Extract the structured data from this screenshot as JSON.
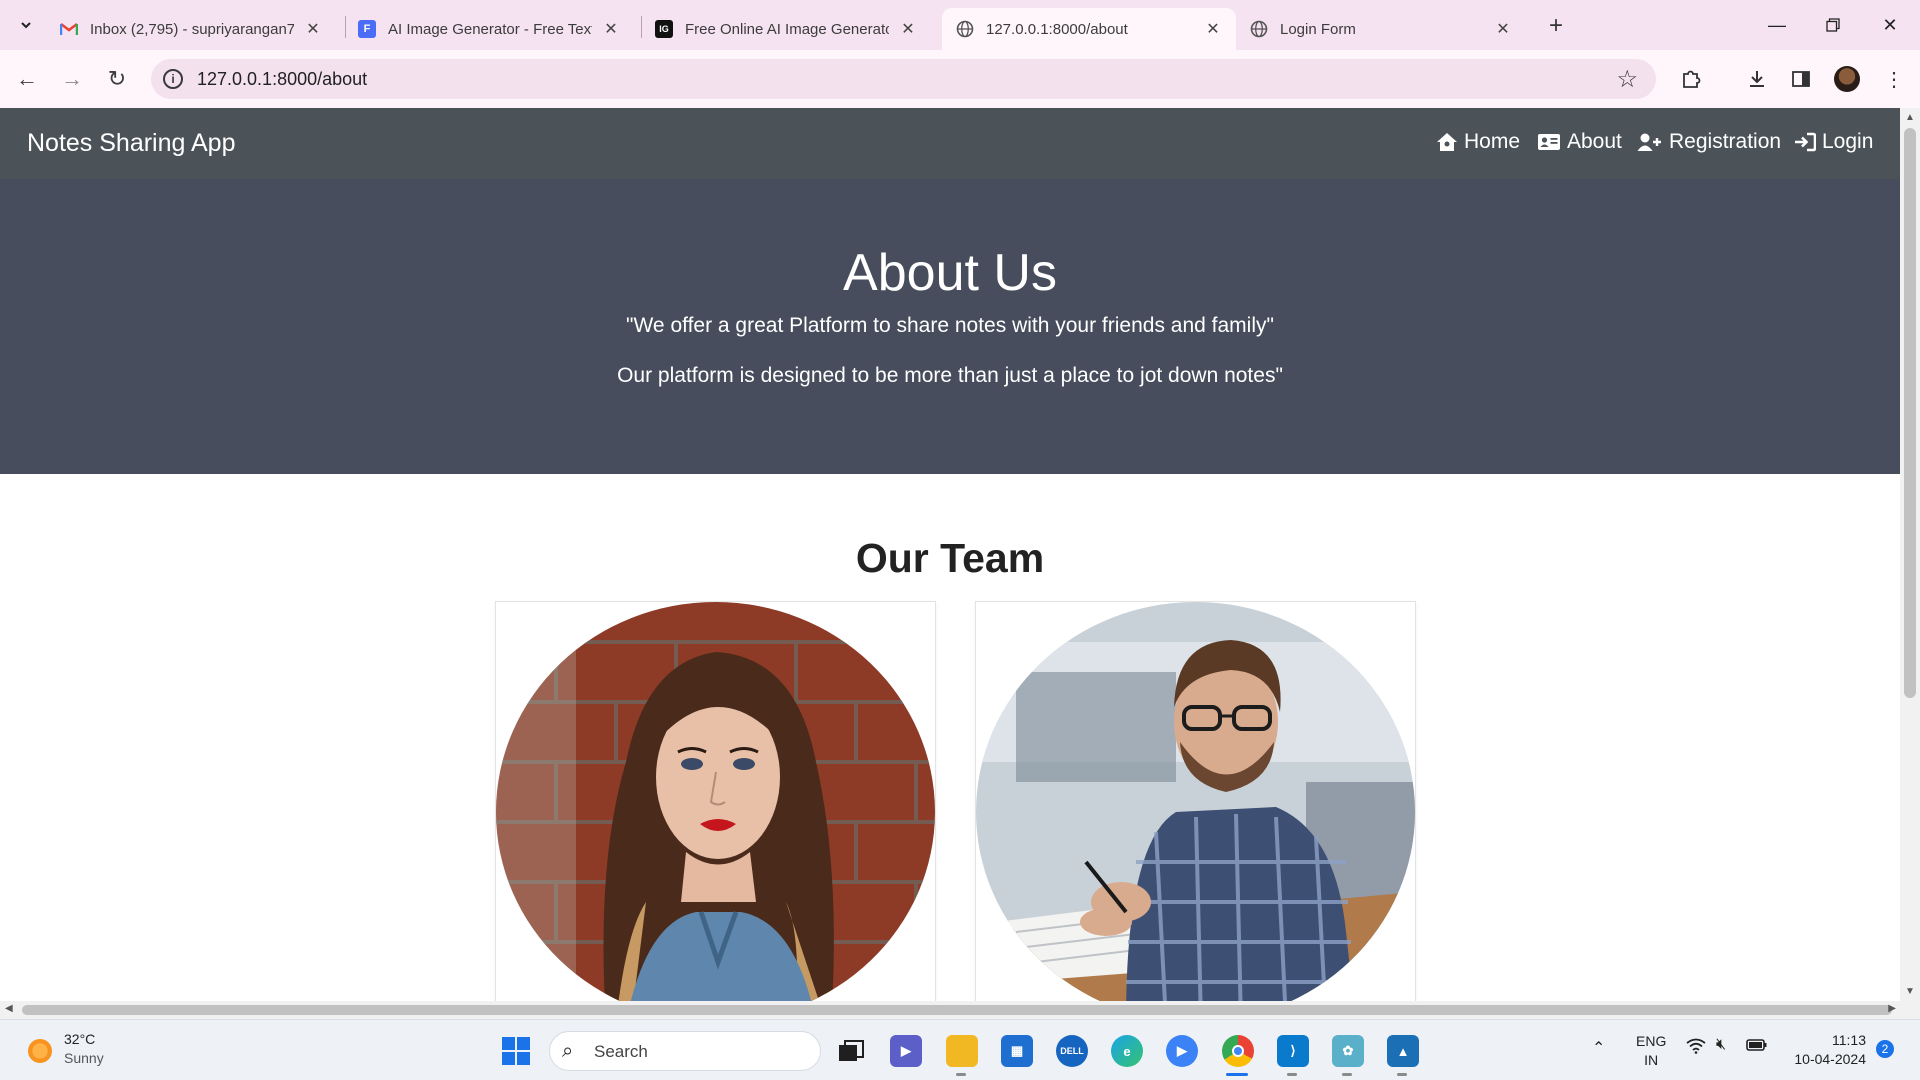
{
  "browser": {
    "tabs": [
      {
        "title": "Inbox (2,795) - supriyarangan71",
        "icon": "gmail-icon"
      },
      {
        "title": "AI Image Generator - Free Text",
        "icon": "docs-icon"
      },
      {
        "title": "Free Online AI Image Generator",
        "icon": "ig-icon"
      },
      {
        "title": "127.0.0.1:8000/about",
        "icon": "globe-icon",
        "active": true
      },
      {
        "title": "Login Form",
        "icon": "globe-icon"
      }
    ],
    "url": "127.0.0.1:8000/about"
  },
  "site": {
    "brand": "Notes Sharing App",
    "nav": {
      "home": "Home",
      "about": "About",
      "registration": "Registration",
      "login": "Login"
    }
  },
  "hero": {
    "title": "About Us",
    "quote_line1": "\"We offer a great Platform to share notes with your friends and family\"",
    "quote_line2": "Our platform is designed to be more than just a place to jot down notes\""
  },
  "team": {
    "title": "Our Team"
  },
  "taskbar": {
    "weather_temp": "32°C",
    "weather_cond": "Sunny",
    "search_placeholder": "Search",
    "lang_top": "ENG",
    "lang_bottom": "IN",
    "time": "11:13",
    "date": "10-04-2024",
    "notification_count": "2"
  },
  "colors": {
    "navbar": "#4b5258",
    "hero": "#474d5c",
    "tabstrip": "#f6e3f1"
  }
}
